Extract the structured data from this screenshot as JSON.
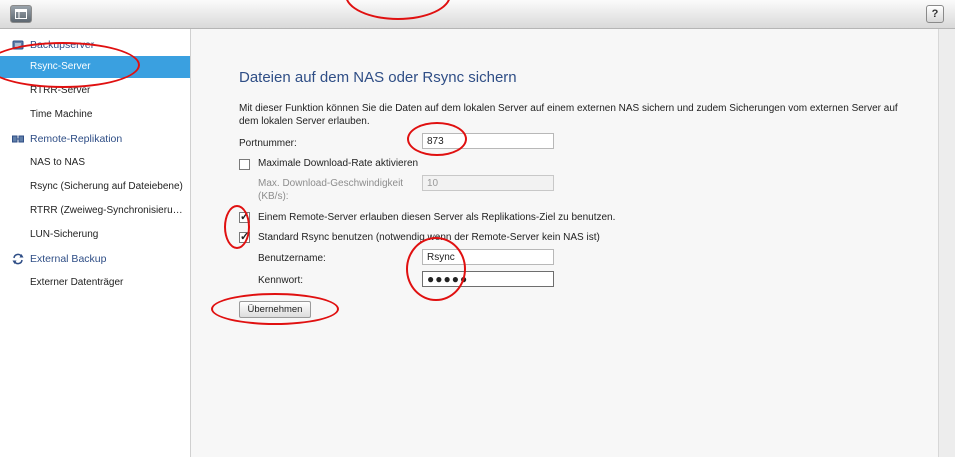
{
  "topbar": {
    "help_label": "?"
  },
  "sidebar": {
    "groups": [
      {
        "label": "Backupserver",
        "icon": "backup-server-icon"
      },
      {
        "label": "Remote-Replikation",
        "icon": "replication-icon"
      },
      {
        "label": "External Backup",
        "icon": "sync-arrows-icon"
      }
    ],
    "items": [
      {
        "label": "Rsync-Server",
        "active": true
      },
      {
        "label": "RTRR-Server"
      },
      {
        "label": "Time Machine"
      },
      {
        "label": "NAS to NAS"
      },
      {
        "label": "Rsync (Sicherung auf Dateiebene)"
      },
      {
        "label": "RTRR (Zweiweg-Synchronisierun..."
      },
      {
        "label": "LUN-Sicherung"
      },
      {
        "label": "Externer Datenträger"
      }
    ]
  },
  "main": {
    "title": "Dateien auf dem NAS oder Rsync sichern",
    "description": "Mit dieser Funktion können Sie die Daten auf dem lokalen Server auf einem externen NAS sichern und zudem Sicherungen vom externen Server auf dem lokalen Server erlauben.",
    "port_label": "Portnummer:",
    "port_value": "873",
    "max_rate_label": "Maximale Download-Rate aktivieren",
    "max_rate_checked": false,
    "max_speed_label_line1": "Max. Download-Geschwindigkeit",
    "max_speed_label_line2": "(KB/s):",
    "max_speed_value": "10",
    "allow_remote_label": "Einem Remote-Server erlauben diesen Server als Replikations-Ziel zu benutzen.",
    "allow_remote_checked": true,
    "std_rsync_label": "Standard Rsync benutzen (notwendig wenn der Remote-Server kein NAS ist)",
    "std_rsync_checked": true,
    "username_label": "Benutzername:",
    "username_value": "Rsync",
    "password_label": "Kennwort:",
    "password_value": "●●●●●",
    "apply_label": "Übernehmen"
  },
  "colors": {
    "accent": "#3aa0e0",
    "heading": "#2f4e86",
    "annotation": "#e01010"
  }
}
